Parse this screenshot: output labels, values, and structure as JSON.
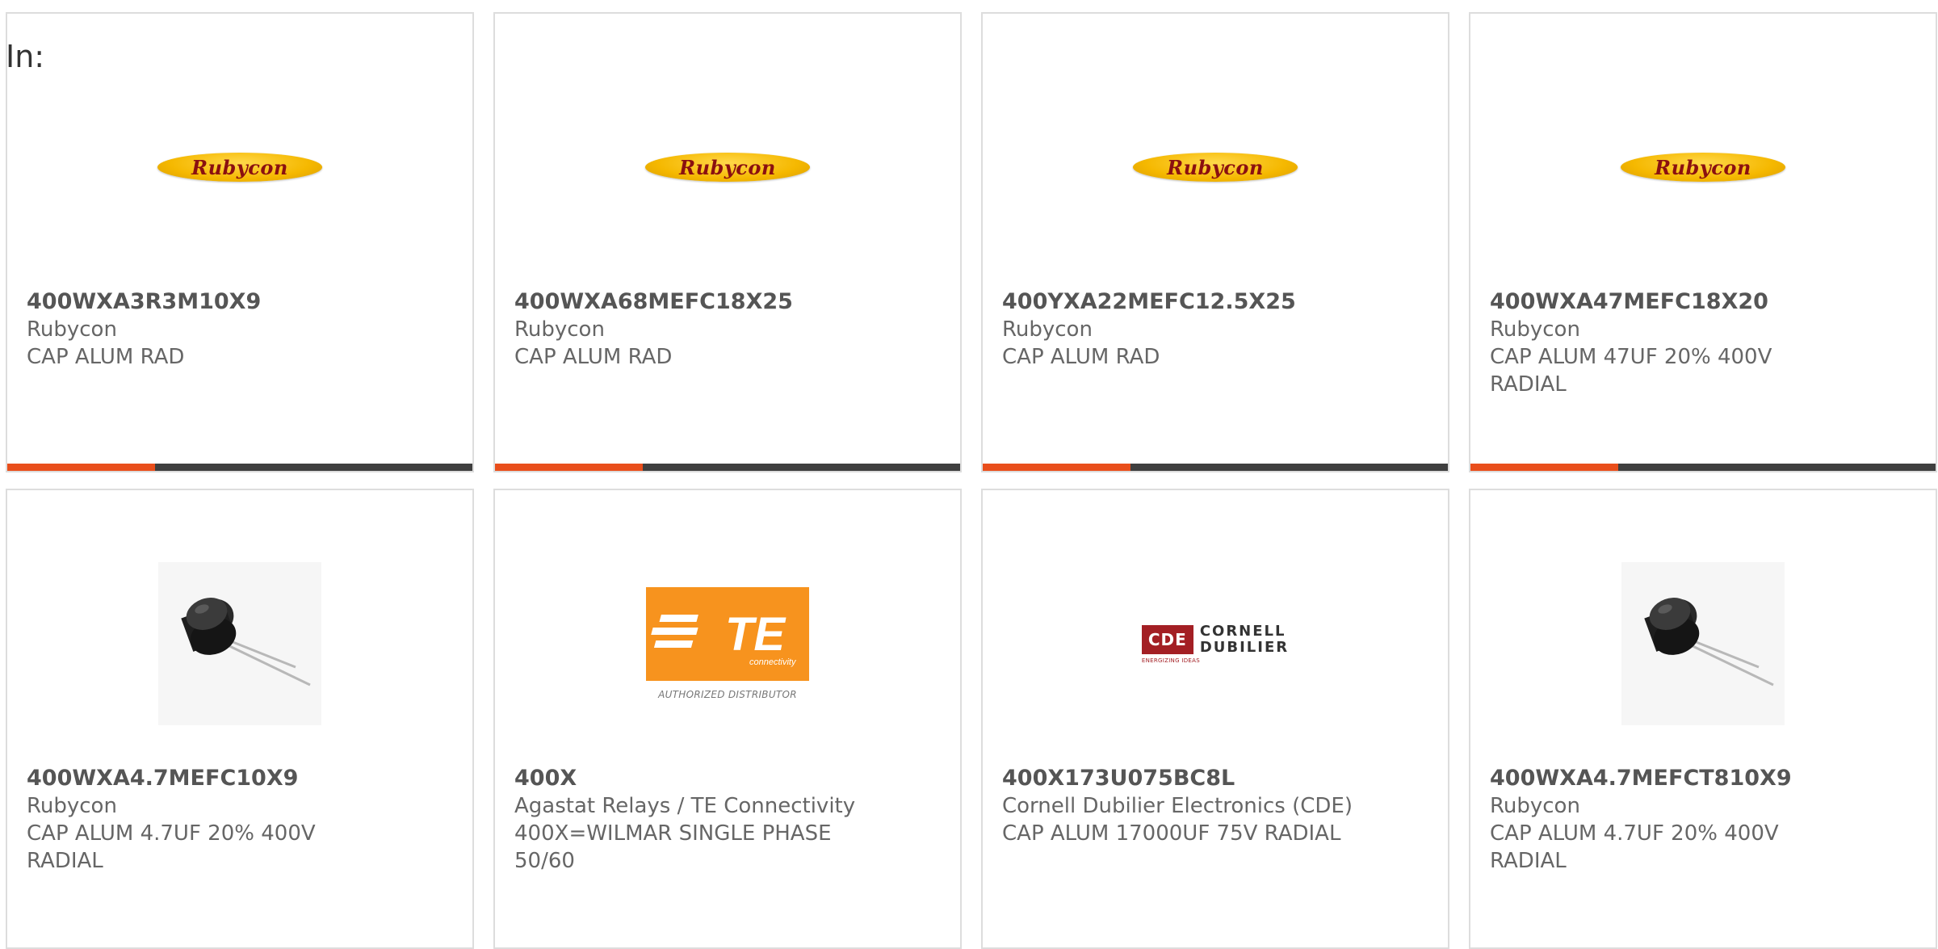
{
  "prefix_label": "In:",
  "cards": [
    {
      "part_number": "400WXA3R3M10X9",
      "manufacturer": "Rubycon",
      "description": "CAP ALUM RAD",
      "image": "rubycon-logo",
      "has_bar": true
    },
    {
      "part_number": "400WXA68MEFC18X25",
      "manufacturer": "Rubycon",
      "description": "CAP ALUM RAD",
      "image": "rubycon-logo",
      "has_bar": true
    },
    {
      "part_number": "400YXA22MEFC12.5X25",
      "manufacturer": "Rubycon",
      "description": "CAP ALUM RAD",
      "image": "rubycon-logo",
      "has_bar": true
    },
    {
      "part_number": "400WXA47MEFC18X20",
      "manufacturer": "Rubycon",
      "description": "CAP ALUM 47UF 20% 400V RADIAL",
      "image": "rubycon-logo",
      "has_bar": true
    },
    {
      "part_number": "400WXA4.7MEFC10X9",
      "manufacturer": "Rubycon",
      "description": "CAP ALUM 4.7UF 20% 400V RADIAL",
      "image": "capacitor-photo",
      "has_bar": false
    },
    {
      "part_number": "400X",
      "manufacturer": "Agastat Relays / TE Connectivity",
      "description": "400X=WILMAR SINGLE PHASE 50/60",
      "image": "te-connectivity-logo",
      "has_bar": false
    },
    {
      "part_number": "400X173U075BC8L",
      "manufacturer": "Cornell Dubilier Electronics (CDE)",
      "description": "CAP ALUM 17000UF 75V RADIAL",
      "image": "cde-logo",
      "has_bar": false
    },
    {
      "part_number": "400WXA4.7MEFCT810X9",
      "manufacturer": "Rubycon",
      "description": "CAP ALUM 4.7UF 20% 400V RADIAL",
      "image": "capacitor-photo",
      "has_bar": false
    }
  ],
  "logos": {
    "rubycon": "Rubycon",
    "te_mark": "TE",
    "te_sub": "connectivity",
    "te_caption": "AUTHORIZED DISTRIBUTOR",
    "cde_box": "CDE",
    "cde_line1": "CORNELL",
    "cde_line2": "DUBILIER",
    "cde_tag": "ENERGIZING IDEAS"
  },
  "colors": {
    "accent": "#e94e1b",
    "bar_dark": "#3f3f3f",
    "rubycon_yellow": "#f5b800",
    "te_orange": "#f7931e",
    "cde_red": "#a31f24"
  }
}
